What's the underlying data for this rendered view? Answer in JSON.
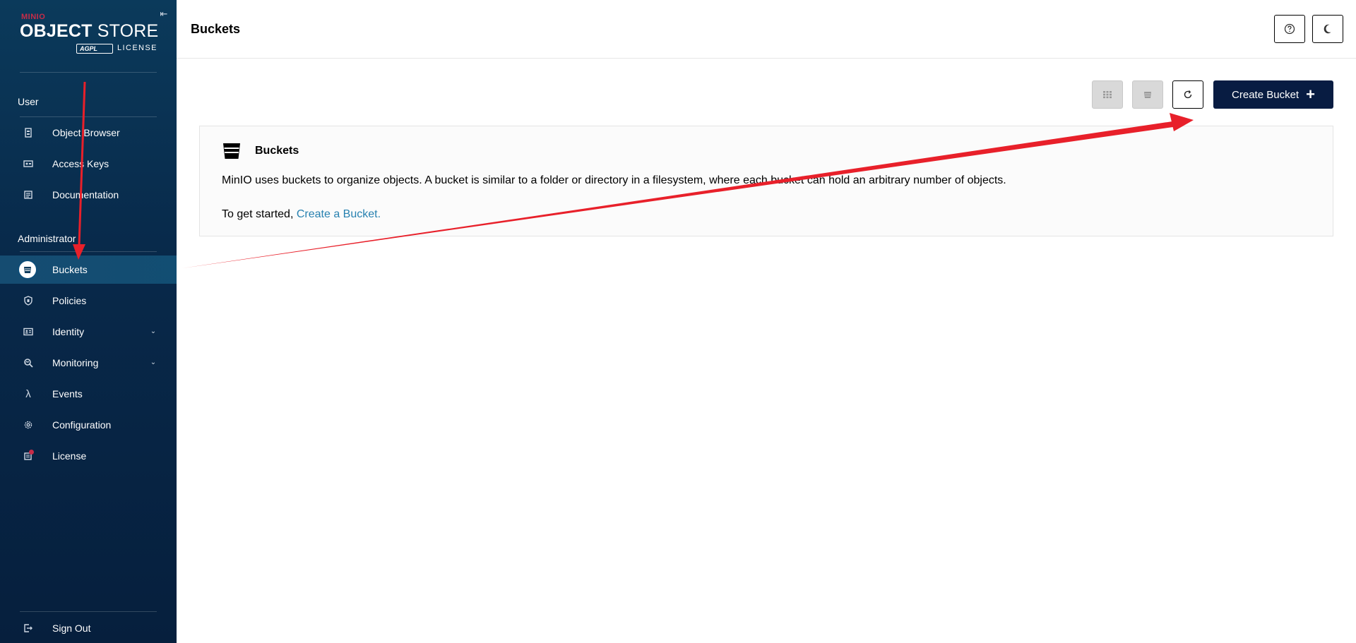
{
  "sidebar": {
    "logo": {
      "brand": "MINIO",
      "product_bold": "OBJECT",
      "product_light": "STORE",
      "badge": "AGPL",
      "license": "LICENSE"
    },
    "sections": [
      {
        "title": "User"
      },
      {
        "title": "Administrator"
      }
    ],
    "user_items": [
      {
        "label": "Object Browser",
        "icon": "object-browser-icon"
      },
      {
        "label": "Access Keys",
        "icon": "access-keys-icon"
      },
      {
        "label": "Documentation",
        "icon": "documentation-icon"
      }
    ],
    "admin_items": [
      {
        "label": "Buckets",
        "icon": "bucket-icon",
        "active": true
      },
      {
        "label": "Policies",
        "icon": "policies-icon"
      },
      {
        "label": "Identity",
        "icon": "identity-icon",
        "expandable": true
      },
      {
        "label": "Monitoring",
        "icon": "monitoring-icon",
        "expandable": true
      },
      {
        "label": "Events",
        "icon": "lambda-icon"
      },
      {
        "label": "Configuration",
        "icon": "gear-icon"
      },
      {
        "label": "License",
        "icon": "license-icon",
        "badge": true
      }
    ],
    "sign_out": "Sign Out"
  },
  "header": {
    "title": "Buckets"
  },
  "toolbar": {
    "create_label": "Create Bucket"
  },
  "panel": {
    "title": "Buckets",
    "description": "MinIO uses buckets to organize objects. A bucket is similar to a folder or directory in a filesystem, where each bucket can hold an arbitrary number of objects.",
    "cta_prefix": "To get started, ",
    "cta_link": "Create a Bucket."
  },
  "colors": {
    "sidebar": "#08294a",
    "accent": "#081c42",
    "brand": "#c72c48",
    "link": "#2781b0",
    "annotation": "#e8202a"
  }
}
